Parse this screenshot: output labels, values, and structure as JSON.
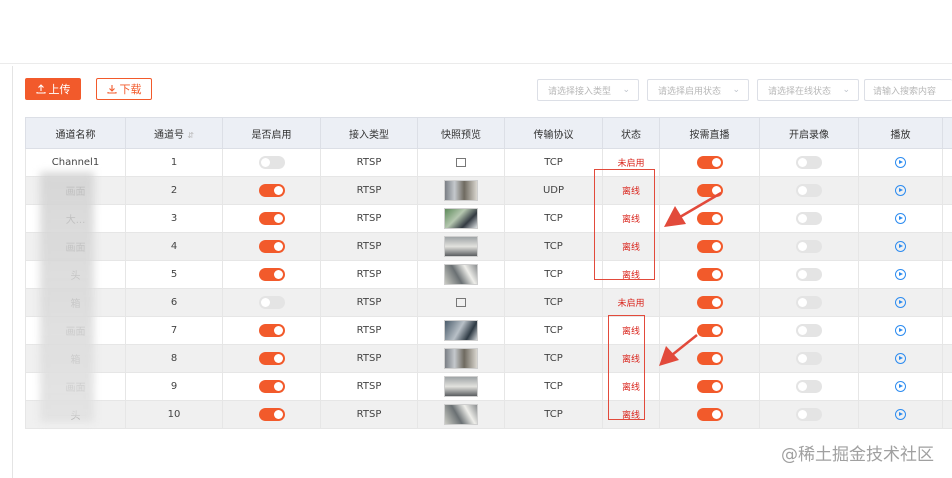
{
  "toolbar": {
    "upload_label": "上传",
    "download_label": "下载"
  },
  "filters": {
    "access_type_placeholder": "请选择接入类型",
    "enable_state_placeholder": "请选择启用状态",
    "online_state_placeholder": "请选择在线状态",
    "search_placeholder": "请输入搜索内容"
  },
  "table": {
    "headers": [
      "通道名称",
      "通道号",
      "是否启用",
      "接入类型",
      "快照预览",
      "传输协议",
      "状态",
      "按需直播",
      "开启录像",
      "播放"
    ],
    "sort_icon": "sort-icon",
    "rows": [
      {
        "name": "Channel1",
        "number": "1",
        "enabled": false,
        "access_type": "RTSP",
        "snapshot": "placeholder",
        "protocol": "TCP",
        "status": "未启用",
        "on_demand": true,
        "record": false
      },
      {
        "name": "画面",
        "number": "2",
        "enabled": true,
        "access_type": "RTSP",
        "snapshot": "t1",
        "protocol": "UDP",
        "status": "离线",
        "on_demand": true,
        "record": false
      },
      {
        "name": "大...",
        "number": "3",
        "enabled": true,
        "access_type": "RTSP",
        "snapshot": "t2",
        "protocol": "TCP",
        "status": "离线",
        "on_demand": true,
        "record": false
      },
      {
        "name": "画面",
        "number": "4",
        "enabled": true,
        "access_type": "RTSP",
        "snapshot": "t3",
        "protocol": "TCP",
        "status": "离线",
        "on_demand": true,
        "record": false
      },
      {
        "name": "头",
        "number": "5",
        "enabled": true,
        "access_type": "RTSP",
        "snapshot": "t4",
        "protocol": "TCP",
        "status": "离线",
        "on_demand": true,
        "record": false
      },
      {
        "name": "箱",
        "number": "6",
        "enabled": false,
        "access_type": "RTSP",
        "snapshot": "placeholder",
        "protocol": "TCP",
        "status": "未启用",
        "on_demand": true,
        "record": false
      },
      {
        "name": "画面",
        "number": "7",
        "enabled": true,
        "access_type": "RTSP",
        "snapshot": "t5",
        "protocol": "TCP",
        "status": "离线",
        "on_demand": true,
        "record": false
      },
      {
        "name": "箱",
        "number": "8",
        "enabled": true,
        "access_type": "RTSP",
        "snapshot": "t1",
        "protocol": "TCP",
        "status": "离线",
        "on_demand": true,
        "record": false
      },
      {
        "name": "画面",
        "number": "9",
        "enabled": true,
        "access_type": "RTSP",
        "snapshot": "t3",
        "protocol": "TCP",
        "status": "离线",
        "on_demand": true,
        "record": false
      },
      {
        "name": "头",
        "number": "10",
        "enabled": true,
        "access_type": "RTSP",
        "snapshot": "t4",
        "protocol": "TCP",
        "status": "离线",
        "on_demand": true,
        "record": false
      }
    ]
  },
  "colors": {
    "accent": "#f25a2b",
    "status_red": "#d9251d",
    "play_blue": "#2d8cf0",
    "annotation_red": "#e24a3b"
  },
  "watermark": "@稀土掘金技术社区"
}
